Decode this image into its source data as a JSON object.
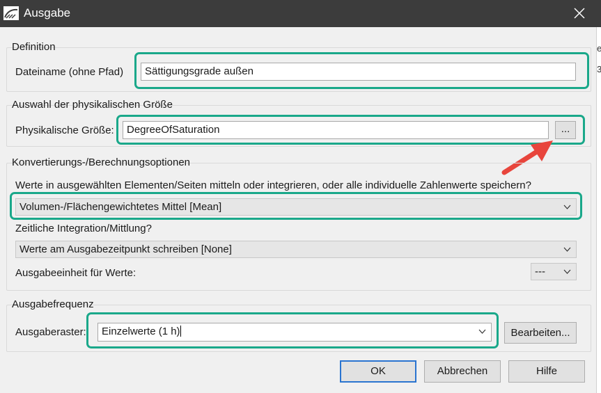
{
  "window": {
    "title": "Ausgabe",
    "app_icon": "landscape-icon",
    "close_icon": "close-x-icon"
  },
  "right_strip_chars": [
    "e",
    "3"
  ],
  "definition": {
    "group_title": "Definition",
    "filename_label": "Dateiname (ohne Pfad)",
    "filename_value": "Sättigungsgrade außen"
  },
  "quantity": {
    "group_title": "Auswahl der physikalischen Größe",
    "label": "Physikalische Größe:",
    "value": "DegreeOfSaturation",
    "browse_label": "..."
  },
  "conversion": {
    "group_title": "Konvertierungs-/Berechnungsoptionen",
    "question1": "Werte in ausgewählten Elementen/Seiten mitteln oder integrieren, oder alle individuelle Zahlenwerte speichern?",
    "average_selected": "Volumen-/Flächengewichtetes Mittel [Mean]",
    "question2": "Zeitliche Integration/Mittlung?",
    "time_selected": "Werte am Ausgabezeitpunkt schreiben [None]",
    "unit_label": "Ausgabeeinheit für Werte:",
    "unit_selected": "---"
  },
  "frequency": {
    "group_title": "Ausgabefrequenz",
    "raster_label": "Ausgaberaster:",
    "raster_value": "Einzelwerte (1 h)",
    "edit_label": "Bearbeiten..."
  },
  "footer": {
    "ok": "OK",
    "cancel": "Abbrechen",
    "help": "Hilfe"
  },
  "colors": {
    "titlebar": "#3c3c3c",
    "highlight": "#1aa88a",
    "arrow": "#e8453c",
    "default_button_border": "#2a74d0"
  }
}
